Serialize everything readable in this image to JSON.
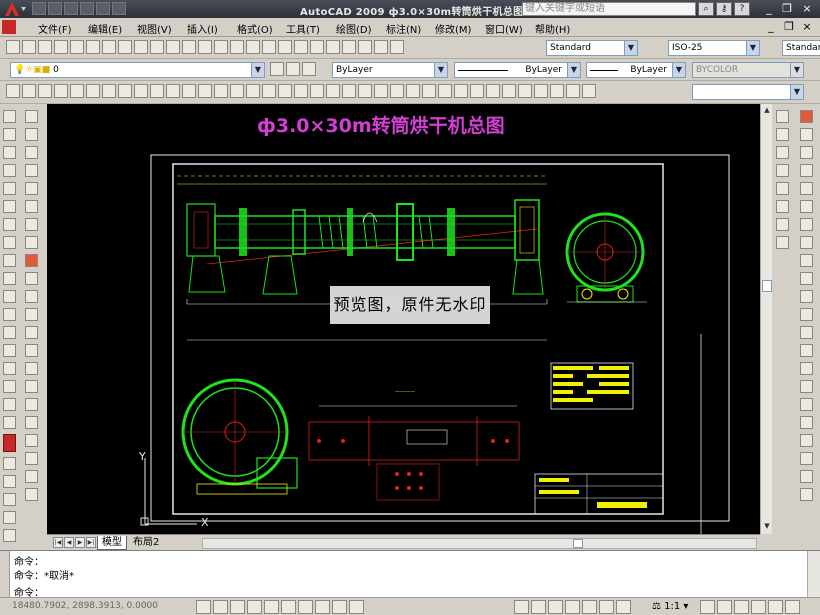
{
  "window": {
    "title": "AutoCAD 2009  ф3.0×30m转筒烘干机总图",
    "search_placeholder": "键入关键字或短语"
  },
  "menu": {
    "items": [
      {
        "label": "文件(F)"
      },
      {
        "label": "编辑(E)"
      },
      {
        "label": "视图(V)"
      },
      {
        "label": "插入(I)"
      },
      {
        "label": "格式(O)"
      },
      {
        "label": "工具(T)"
      },
      {
        "label": "绘图(D)"
      },
      {
        "label": "标注(N)"
      },
      {
        "label": "修改(M)"
      },
      {
        "label": "窗口(W)"
      },
      {
        "label": "帮助(H)"
      }
    ]
  },
  "toolbars": {
    "text_style": "Standard",
    "dim_style": "ISO-25",
    "table_style": "Standar",
    "layer": "0",
    "color": "ByLayer",
    "linetype": "ByLayer",
    "lineweight": "ByLayer",
    "plotstyle": "BYCOLOR"
  },
  "drawing": {
    "title": "ф3.0×30m转筒烘干机总图",
    "watermark": "预览图，原件无水印",
    "ucs_x": "X",
    "ucs_y": "Y"
  },
  "tabs": [
    {
      "label": "模型",
      "active": true
    },
    {
      "label": "布局2",
      "active": false
    }
  ],
  "command": {
    "line1": "命令：",
    "line2": "命令：*取消*",
    "line3": "命令："
  },
  "status": {
    "coords": "18480.7902, 2898.3913, 0.0000",
    "annotation_scale": "1:1"
  },
  "colors": {
    "drawing_bg": "#000000",
    "title": "#d23fd2",
    "green": "#1de21d",
    "yellow": "#f0f000",
    "red": "#e52020",
    "white": "#e8e8e8"
  }
}
